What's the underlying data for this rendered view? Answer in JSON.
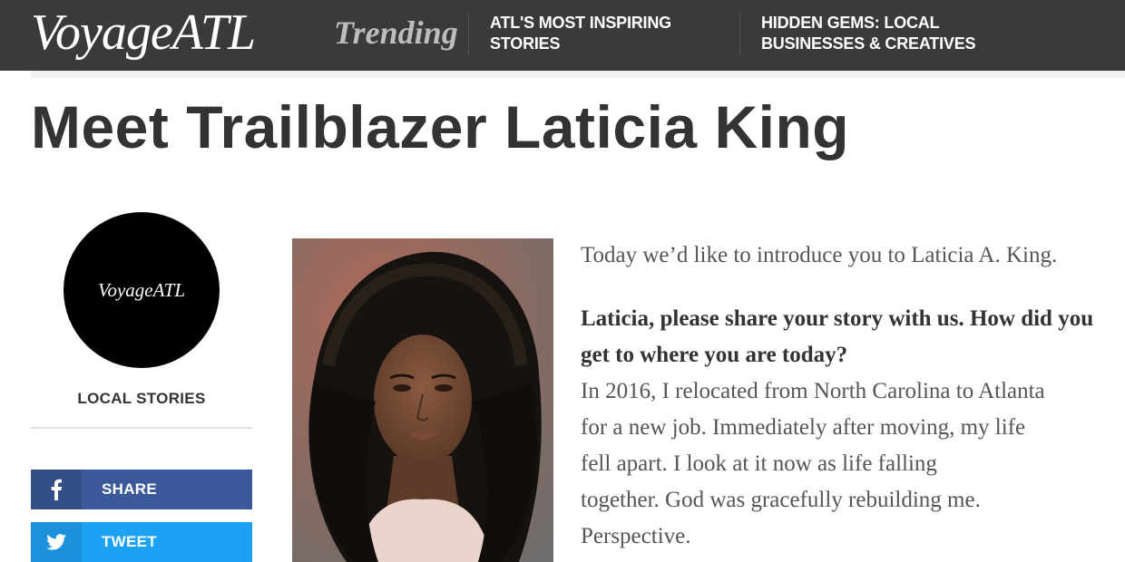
{
  "header": {
    "logo": "VoyageATL",
    "trending_label": "Trending",
    "nav": [
      {
        "line1": "ATL'S MOST INSPIRING",
        "line2": "STORIES"
      },
      {
        "line1": "HIDDEN GEMS: LOCAL",
        "line2": "BUSINESSES & CREATIVES"
      }
    ]
  },
  "article": {
    "title": "Meet Trailblazer Laticia King",
    "intro": "Today we’d like to introduce you to Laticia A. King.",
    "question": "Laticia, please share your story with us. How did you get to where you are today?",
    "answer_lines": [
      "In 2016, I relocated from North Carolina to Atlanta",
      "for a new job. Immediately after moving, my life",
      "fell apart. I look at it now as life falling",
      "together. God was gracefully rebuilding me.",
      "Perspective."
    ]
  },
  "sidebar": {
    "avatar_text": "VoyageATL",
    "category": "LOCAL STORIES",
    "share_label": "SHARE",
    "tweet_label": "TWEET"
  },
  "colors": {
    "header_bg": "#3a3a3a",
    "facebook": "#3b5998",
    "twitter": "#1da1f2"
  },
  "icons": {
    "share": "facebook-icon",
    "tweet": "twitter-icon"
  }
}
